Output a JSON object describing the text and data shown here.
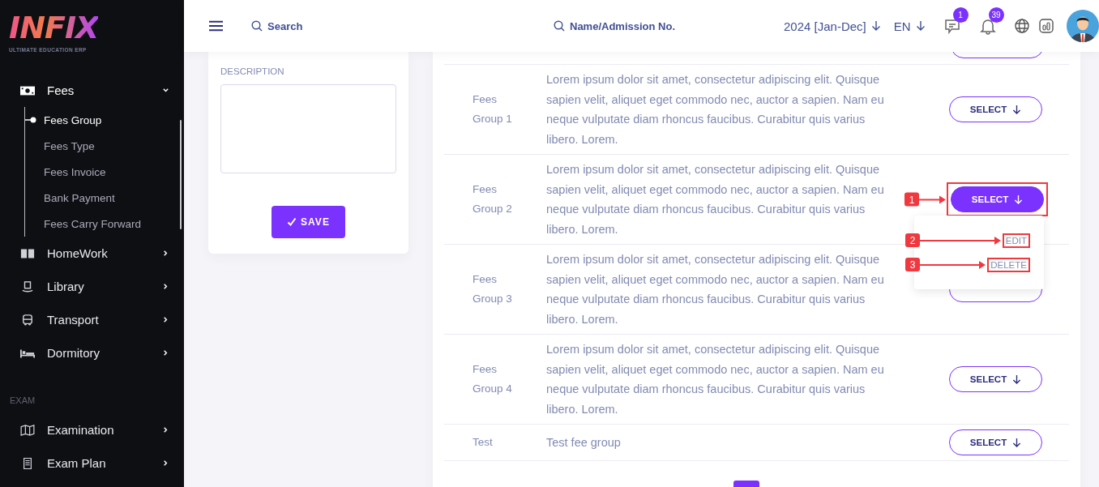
{
  "sidebar": {
    "logo": "INFIX",
    "tagline": "ULTIMATE EDUCATION ERP",
    "menu": [
      {
        "kind": "item",
        "label": "Fees",
        "expanded": true,
        "children": [
          {
            "label": "Fees Group",
            "selected": true
          },
          {
            "label": "Fees Type",
            "selected": false
          },
          {
            "label": "Fees Invoice",
            "selected": false
          },
          {
            "label": "Bank Payment",
            "selected": false
          },
          {
            "label": "Fees Carry Forward",
            "selected": false
          }
        ]
      },
      {
        "kind": "item",
        "label": "HomeWork",
        "expanded": false
      },
      {
        "kind": "item",
        "label": "Library",
        "expanded": false
      },
      {
        "kind": "item",
        "label": "Transport",
        "expanded": false
      },
      {
        "kind": "item",
        "label": "Dormitory",
        "expanded": false
      },
      {
        "kind": "heading",
        "label": "EXAM"
      },
      {
        "kind": "item",
        "label": "Examination",
        "expanded": false
      },
      {
        "kind": "item",
        "label": "Exam Plan",
        "expanded": false
      }
    ]
  },
  "header": {
    "search": {
      "placeholder": "Search"
    },
    "student_search": {
      "placeholder": "Name/Admission No."
    },
    "session": "2024 [Jan-Dec]",
    "language": "EN",
    "messages_badge": "1",
    "notifications_badge": "39"
  },
  "form": {
    "description_label": "DESCRIPTION",
    "save_button": "SAVE"
  },
  "table": {
    "rows": [
      {
        "name": "Fees Group 1",
        "description": "Lorem ipsum dolor sit amet, consectetur adipiscing elit. Quisque sapien velit, aliquet eget commodo nec, auctor a sapien. Nam eu neque vulputate diam rhoncus faucibus. Curabitur quis varius libero. Lorem.",
        "action": "SELECT",
        "menu_open": false
      },
      {
        "name": "Fees Group 2",
        "description": "Lorem ipsum dolor sit amet, consectetur adipiscing elit. Quisque sapien velit, aliquet eget commodo nec, auctor a sapien. Nam eu neque vulputate diam rhoncus faucibus. Curabitur quis varius libero. Lorem.",
        "action": "SELECT",
        "menu_open": true,
        "annotation": "1",
        "menu": [
          {
            "label": "EDIT",
            "annotation": "2"
          },
          {
            "label": "DELETE",
            "annotation": "3"
          }
        ]
      },
      {
        "name": "Fees Group 3",
        "description": "Lorem ipsum dolor sit amet, consectetur adipiscing elit. Quisque sapien velit, aliquet eget commodo nec, auctor a sapien. Nam eu neque vulputate diam rhoncus faucibus. Curabitur quis varius libero. Lorem.",
        "menu_open": false
      },
      {
        "name": "Fees Group 4",
        "description": "Lorem ipsum dolor sit amet, consectetur adipiscing elit. Quisque sapien velit, aliquet eget commodo nec, auctor a sapien. Nam eu neque vulputate diam rhoncus faucibus. Curabitur quis varius libero. Lorem.",
        "action": "SELECT",
        "menu_open": false
      },
      {
        "name": "Test",
        "description": "Test fee group",
        "action": "SELECT",
        "menu_open": false
      }
    ]
  }
}
